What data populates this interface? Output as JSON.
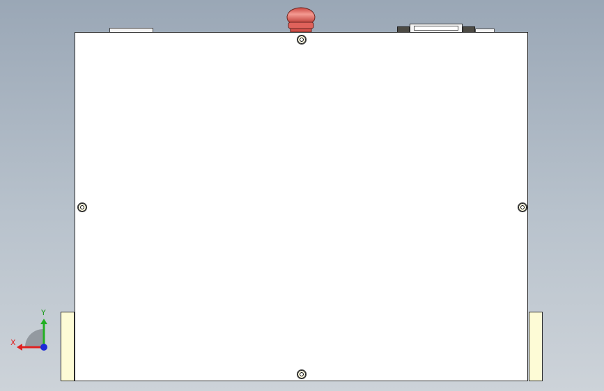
{
  "cad_view": {
    "view": "front",
    "colors": {
      "background_top": "#9aa7b6",
      "background_bottom": "#cdd3d9",
      "panel_fill": "#ffffff",
      "foot_fill": "#fdfbd6",
      "emergency_stop": "#e8706a",
      "outline": "#2b2b2b"
    },
    "triad": {
      "x_label": "X",
      "y_label": "Y",
      "x_axis_color": "#e02020",
      "y_axis_color": "#22b022",
      "z_axis_color": "#1e2bd8"
    }
  }
}
